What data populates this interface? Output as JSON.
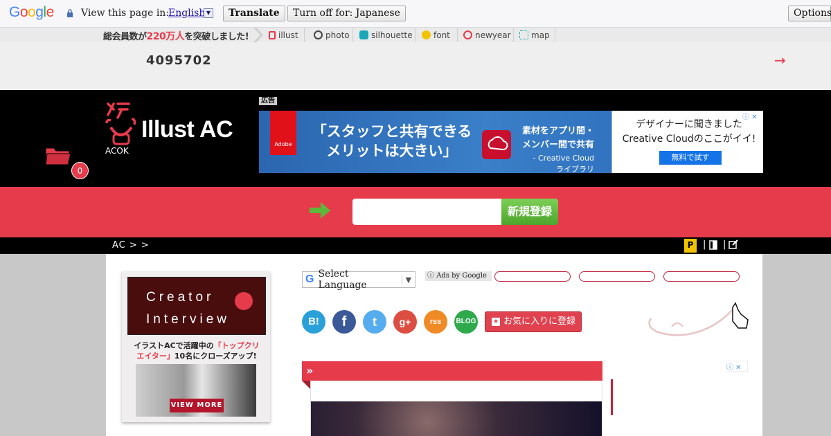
{
  "translate_bar": {
    "logo": "Google",
    "view_label": "View this page in:",
    "language": "English",
    "translate_button": "Translate",
    "turn_off_button": "Turn off for: Japanese",
    "options_button": "Options"
  },
  "topnav": {
    "members_prefix": "総会員数が",
    "members_count": "220万人",
    "members_suffix": "を突破しました!",
    "items": [
      {
        "label": "illust",
        "icon": "illust-icon"
      },
      {
        "label": "photo",
        "icon": "photo-icon"
      },
      {
        "label": "silhouette",
        "icon": "silhouette-icon"
      },
      {
        "label": "font",
        "icon": "font-icon"
      },
      {
        "label": "newyear",
        "icon": "newyear-icon"
      },
      {
        "label": "map",
        "icon": "map-icon"
      }
    ]
  },
  "id_band": {
    "id": "4095702",
    "arrow": "→"
  },
  "header": {
    "logo_text": "Illust AC",
    "acok": "ACOK",
    "cart_count": "0",
    "ad_label": "広告",
    "ad": {
      "brand": "Adobe",
      "headline_1": "「スタッフと共有できる",
      "headline_2": "メリットは大きい」",
      "mid_1": "素材をアプリ間・",
      "mid_2": "メンバー間で共有",
      "mid_3": "- Creative Cloud",
      "mid_4": "ライブラリ",
      "right_1": "デザイナーに聞きました",
      "right_2": "Creative Cloudのここがイイ!",
      "try_button": "無料で試す"
    }
  },
  "search": {
    "placeholder": "",
    "register_button": "新規登録"
  },
  "breadcrumb": {
    "text": "AC >  >",
    "p_badge": "P"
  },
  "sidebar_ad": {
    "line1": "Creator",
    "line2": "Interview",
    "sub_1a": "イラストACで活躍中の",
    "sub_1b": "「トップクリ",
    "sub_2a": "エイター」",
    "sub_2b": "10名にクローズアップ!",
    "view_more": "VIEW MORE"
  },
  "main": {
    "select_language": "Select Language",
    "ads_by_google": "Ads by Google",
    "favorite_button": "お気に入りに登録",
    "social": [
      {
        "label": "B!",
        "icon": "hatena-bookmark-icon",
        "color": "#2aa0d8"
      },
      {
        "label": "f",
        "icon": "facebook-icon",
        "color": "#3b5998"
      },
      {
        "label": "t",
        "icon": "twitter-icon",
        "color": "#55acee"
      },
      {
        "label": "g+",
        "icon": "google-plus-icon",
        "color": "#dc4e41"
      },
      {
        "label": "rss",
        "icon": "rss-icon",
        "color": "#f08a24"
      },
      {
        "label": "BLOG",
        "icon": "blog-icon",
        "color": "#2ea94b"
      }
    ],
    "red_tab_chevron": "»"
  },
  "colors": {
    "brand_red": "#e63b4b",
    "green": "#5cb83a"
  }
}
